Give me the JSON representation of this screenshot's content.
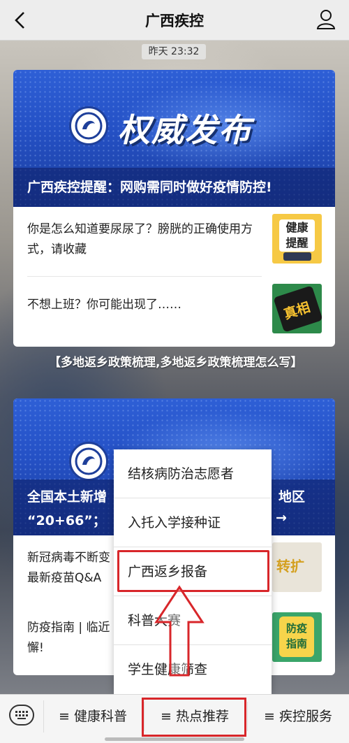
{
  "topbar": {
    "title": "广西疾控"
  },
  "time_chip": "昨天 23:32",
  "card1": {
    "banner_heading": "权威发布",
    "banner_caption": "广西疾控提醒：网购需同时做好疫情防控!",
    "items": [
      {
        "text": "你是怎么知道要尿尿了？膀胱的正确使用方式，请收藏",
        "thumb_label": "健康提醒"
      },
      {
        "text": "不想上班？你可能出现了……",
        "thumb_label": "真相"
      }
    ]
  },
  "overlay_title": "【多地返乡政策梳理,多地返乡政策梳理怎么写】",
  "card2": {
    "banner_caption_left": "全国本土新增",
    "banner_caption_right": "地区",
    "banner_caption2_left": "“20+66”；",
    "banner_caption2_right": "→",
    "items": [
      {
        "text": "新冠病毒不断变最新疫苗Q&A",
        "thumb_label": "转扩"
      },
      {
        "text": "防疫指南 | 临近懈!",
        "thumb_label": "防疫指南"
      }
    ]
  },
  "popup_menu": {
    "items": [
      "结核病防治志愿者",
      "入托入学接种证",
      "广西返乡报备",
      "科普大赛",
      "学生健康筛查"
    ],
    "highlighted_index": 2
  },
  "bottom_menu": {
    "tabs": [
      "≡ 健康科普",
      "≡ 热点推荐",
      "≡ 疾控服务"
    ],
    "highlighted_index": 1
  },
  "colors": {
    "highlight": "#d8262a",
    "banner_blue": "#2450c4"
  }
}
